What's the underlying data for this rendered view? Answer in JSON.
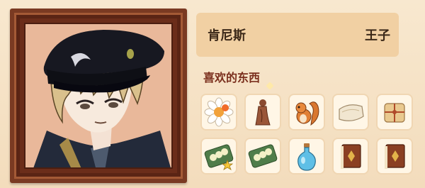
{
  "character": {
    "name": "肯尼斯",
    "title": "王子"
  },
  "likes": {
    "label": "喜欢的东西",
    "items": [
      {
        "icon": "daisy-flower-icon"
      },
      {
        "icon": "wooden-figurine-icon"
      },
      {
        "icon": "squirrel-icon"
      },
      {
        "icon": "cloth-bundle-icon"
      },
      {
        "icon": "tied-package-icon"
      },
      {
        "icon": "dango-tray-star-icon"
      },
      {
        "icon": "dango-tray-icon"
      },
      {
        "icon": "blue-potion-icon"
      },
      {
        "icon": "brown-book-icon"
      },
      {
        "icon": "brown-book-icon"
      }
    ]
  },
  "colors": {
    "frame": "#7a3a22",
    "name_bar": "#f1d0a3",
    "likes_label": "#7a2e1c"
  }
}
